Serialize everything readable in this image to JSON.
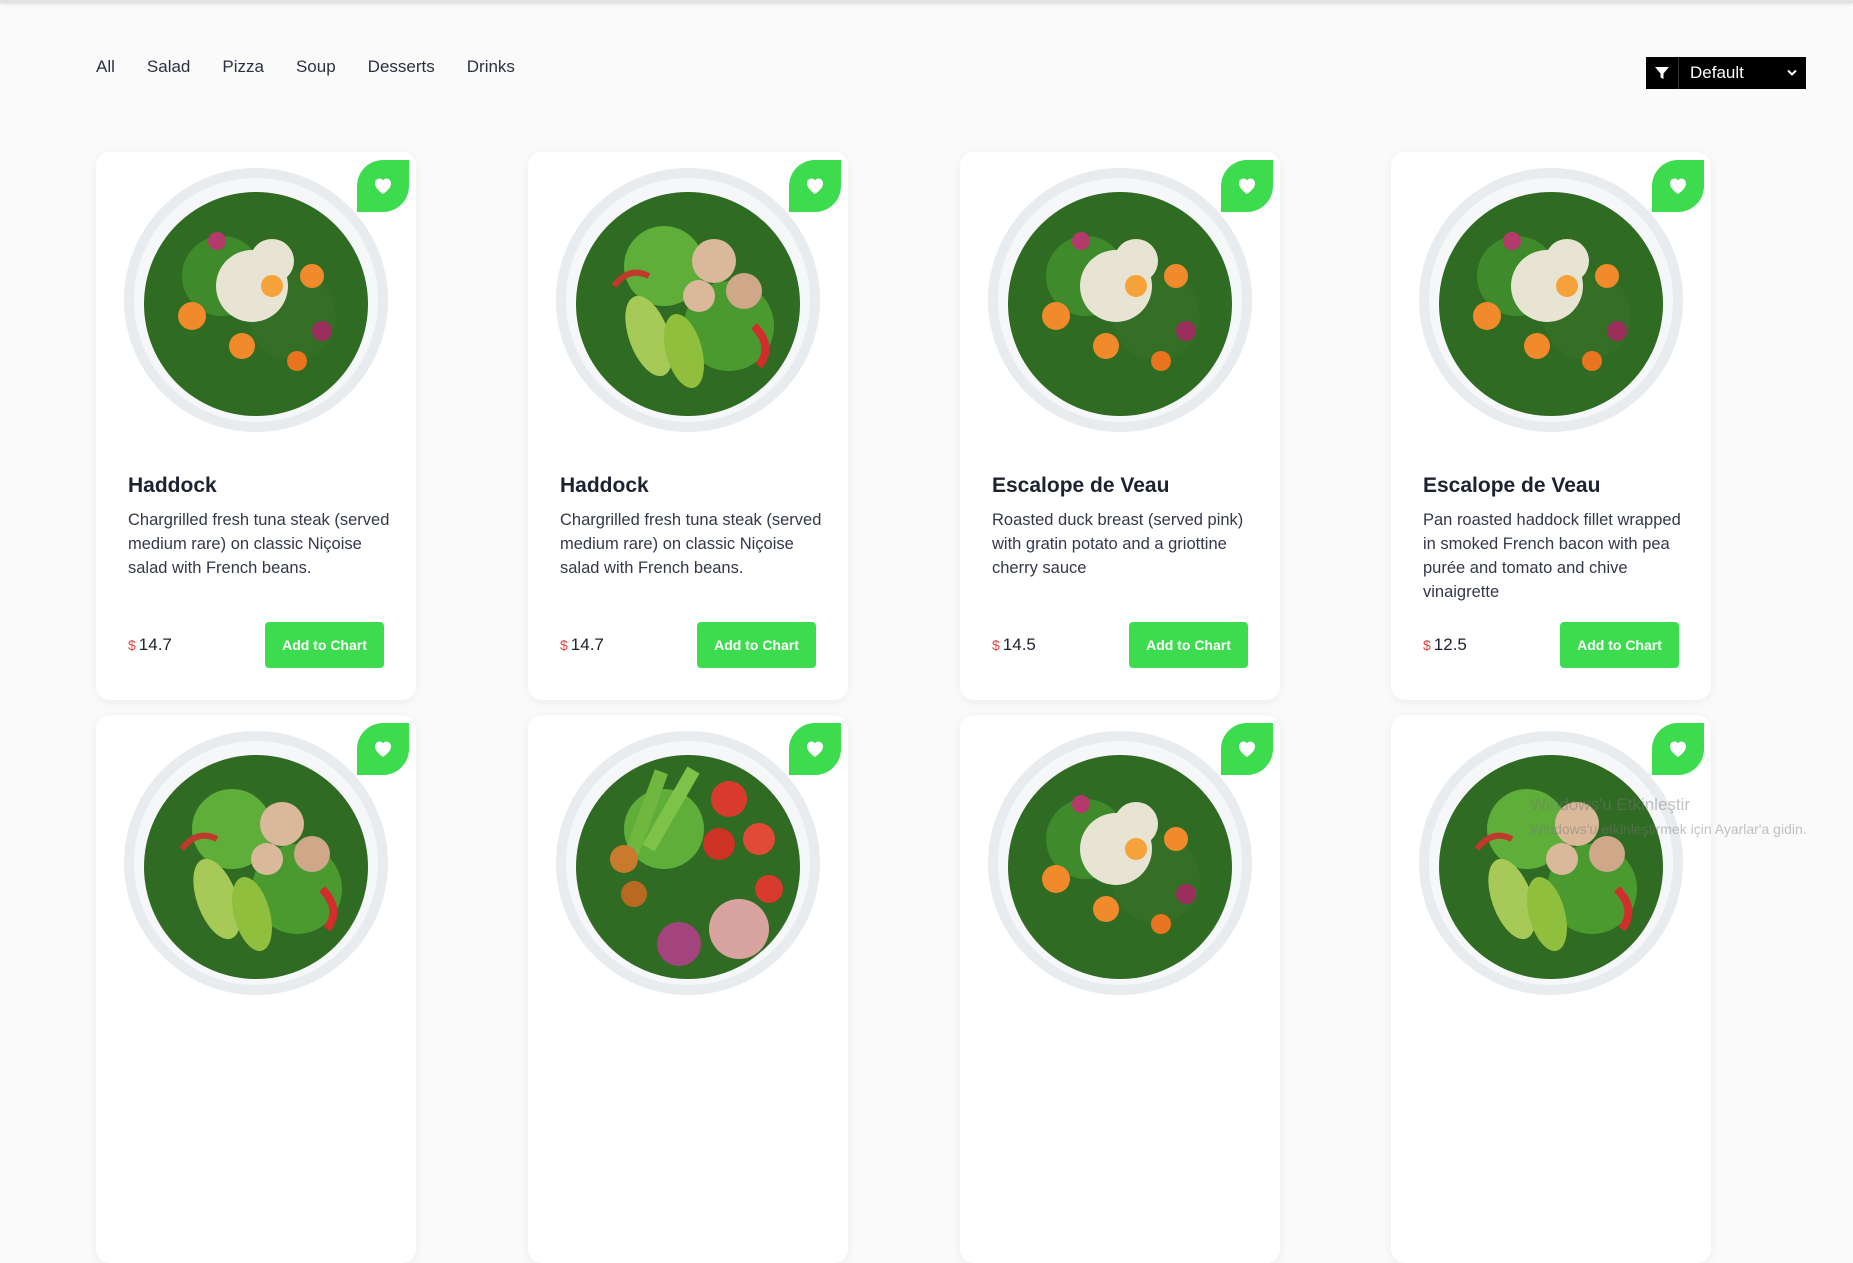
{
  "tabs": [
    "All",
    "Salad",
    "Pizza",
    "Soup",
    "Desserts",
    "Drinks"
  ],
  "sort": {
    "selected": "Default",
    "icon": "filter-icon"
  },
  "colors": {
    "accent": "#3ddc4f",
    "currency": "#e0453f",
    "sort_bg": "#000000"
  },
  "products": [
    {
      "name": "Haddock",
      "description": "Chargrilled fresh tuna steak (served medium rare) on classic Niçoise salad with French beans.",
      "currency": "$",
      "price": "14.7",
      "button": "Add to Chart",
      "image": "salad-bowl-kale"
    },
    {
      "name": "Haddock",
      "description": "Chargrilled fresh tuna steak (served medium rare) on classic Niçoise salad with French beans.",
      "currency": "$",
      "price": "14.7",
      "button": "Add to Chart",
      "image": "salad-bowl-avocado"
    },
    {
      "name": "Escalope de Veau",
      "description": "Roasted duck breast (served pink) with gratin potato and a griottine cherry sauce",
      "currency": "$",
      "price": "14.5",
      "button": "Add to Chart",
      "image": "salad-bowl-kale"
    },
    {
      "name": "Escalope de Veau",
      "description": "Pan roasted haddock fillet wrapped in smoked French bacon with pea purée and tomato and chive vinaigrette",
      "currency": "$",
      "price": "12.5",
      "button": "Add to Chart",
      "image": "salad-bowl-kale"
    },
    {
      "image": "salad-bowl-avocado"
    },
    {
      "image": "salad-bowl-tuna-beans"
    },
    {
      "image": "salad-bowl-kale"
    },
    {
      "image": "salad-bowl-avocado"
    }
  ],
  "watermark": {
    "line1": "Windows'u Etkinleştir",
    "line2": "Windows'u etkinleştirmek için Ayarlar'a gidin."
  }
}
